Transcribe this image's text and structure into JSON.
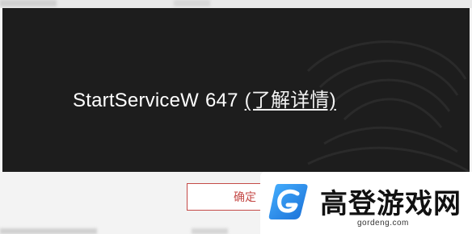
{
  "dialog": {
    "service_name": "StartServiceW",
    "error_code": "647",
    "details_link": "(了解详情)",
    "ok_label": "确定"
  },
  "watermark": {
    "title": "高登游戏网",
    "domain": "gordeng.com"
  },
  "colors": {
    "dialog_bg": "#1d1d1d",
    "button_accent": "#c44a47",
    "logo_blue": "#2f8fe8"
  }
}
